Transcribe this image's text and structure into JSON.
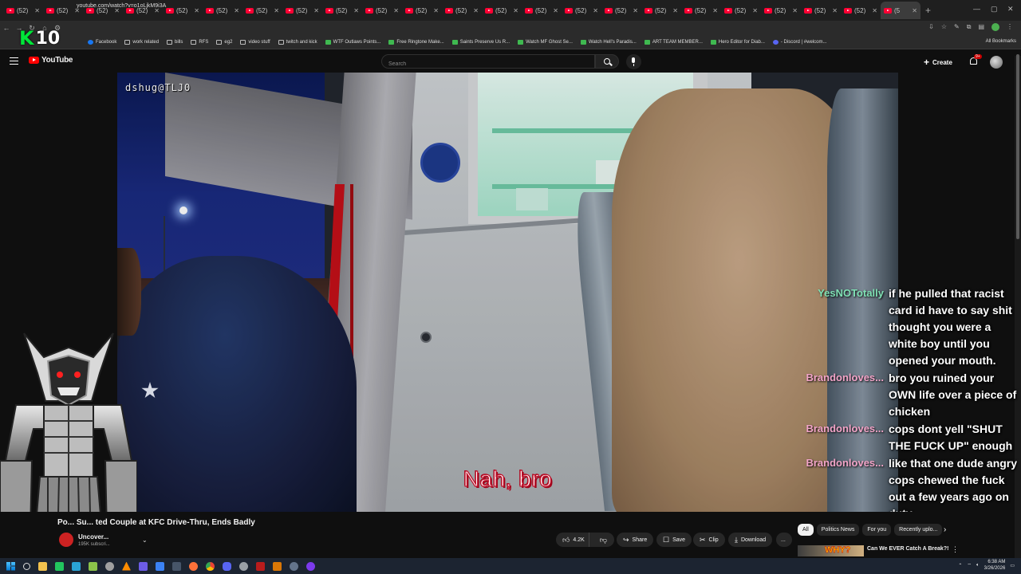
{
  "browser": {
    "tabs": [
      {
        "label": "(52)"
      },
      {
        "label": "(52)"
      },
      {
        "label": "(52)"
      },
      {
        "label": "(52)"
      },
      {
        "label": "(52)"
      },
      {
        "label": "(52)"
      },
      {
        "label": "(52)"
      },
      {
        "label": "(52)"
      },
      {
        "label": "(52)"
      },
      {
        "label": "(52)"
      },
      {
        "label": "(52)"
      },
      {
        "label": "(52)"
      },
      {
        "label": "(52)"
      },
      {
        "label": "(52)"
      },
      {
        "label": "(52)"
      },
      {
        "label": "(52)"
      },
      {
        "label": "(52)"
      },
      {
        "label": "(52)"
      },
      {
        "label": "(52)"
      },
      {
        "label": "(52)"
      },
      {
        "label": "(52)"
      },
      {
        "label": "(52)"
      },
      {
        "label": "(5"
      }
    ],
    "url": "youtube.com/watch?v=o1oLjkM9i3A",
    "bookmarks": [
      {
        "label": "Facebook",
        "icon": "facebook-icon"
      },
      {
        "label": "work related",
        "icon": "folder-icon"
      },
      {
        "label": "bills",
        "icon": "folder-icon"
      },
      {
        "label": "RFS",
        "icon": "folder-icon"
      },
      {
        "label": "eg2",
        "icon": "folder-icon"
      },
      {
        "label": "video stuff",
        "icon": "folder-icon"
      },
      {
        "label": "twitch and kick",
        "icon": "folder-icon"
      },
      {
        "label": "WTF Outlaws Points...",
        "icon": "site-icon"
      },
      {
        "label": "Free Ringtone Make...",
        "icon": "site-icon"
      },
      {
        "label": "Saints Preserve Us R...",
        "icon": "site-icon"
      },
      {
        "label": "Watch MF Ghost Se...",
        "icon": "site-icon"
      },
      {
        "label": "Watch Hell's Paradis...",
        "icon": "site-icon"
      },
      {
        "label": "ART TEAM MEMBER...",
        "icon": "site-icon"
      },
      {
        "label": "Hero Editor for Diab...",
        "icon": "site-icon"
      },
      {
        "label": "- Discord | #welcom...",
        "icon": "discord-icon"
      }
    ],
    "all_bookmarks": "All Bookmarks"
  },
  "overlay_logo": {
    "k": "K",
    "number": "10"
  },
  "youtube": {
    "logo_text": "YouTube",
    "search_placeholder": "Search",
    "create_label": "Create",
    "notification_badge": "9+"
  },
  "video": {
    "watermark": "dshug@TLJ0",
    "subtitle": "Nah, bro"
  },
  "chat": [
    {
      "user": "YesNOTotally",
      "color": "#7fe0b4",
      "text": "if he pulled that racist card id have to say shit thought you were a white boy until you opened your mouth."
    },
    {
      "user": "Brandonloves...",
      "color": "#f2a4c8",
      "text": "bro you ruined your OWN life over a piece of chicken"
    },
    {
      "user": "Brandonloves...",
      "color": "#f2a4c8",
      "text": "cops dont yell \"SHUT THE FUCK UP\" enough"
    },
    {
      "user": "Brandonloves...",
      "color": "#f2a4c8",
      "text": "like that one dude angry cops chewed the fuck out a few years ago on duty"
    }
  ],
  "below_video": {
    "title": "Po...  Su...  ted Couple at KFC Drive-Thru, Ends Badly",
    "channel_name": "Uncover...",
    "channel_subs": "195K subscri...",
    "likes": "4.2K",
    "share": "Share",
    "save": "Save",
    "clip": "Clip",
    "download": "Download",
    "more": "..."
  },
  "chips": [
    {
      "label": "All",
      "active": true
    },
    {
      "label": "Politics News",
      "active": false
    },
    {
      "label": "For you",
      "active": false
    },
    {
      "label": "Recently uplo...",
      "active": false
    }
  ],
  "recommendation": {
    "thumb_text": "WHY?",
    "title": "Can We EVER Catch A Break?!"
  },
  "taskbar": {
    "clock_time": "6:38 AM",
    "clock_date": "3/26/2026"
  }
}
